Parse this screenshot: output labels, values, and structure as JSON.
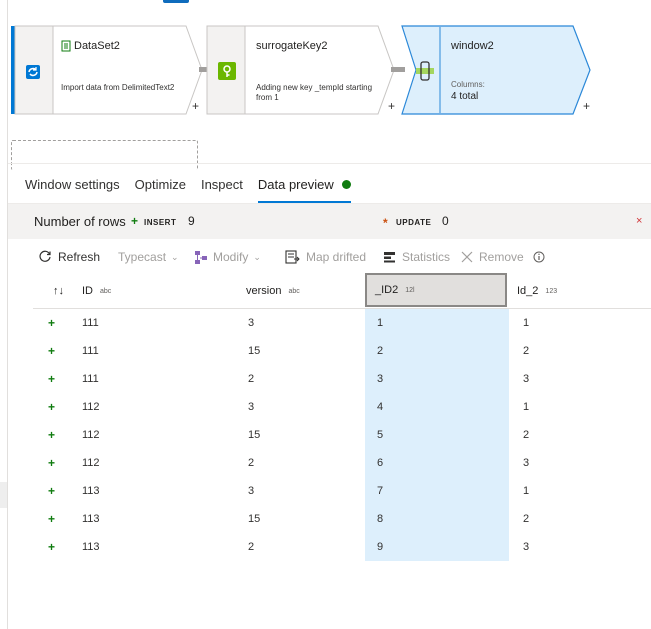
{
  "pipeline": {
    "nodes": [
      {
        "title": "DataSet2",
        "description": "Import data from DelimitedText2",
        "icon": "dataset-source-icon"
      },
      {
        "title": "surrogateKey2",
        "description": "Adding new key _tempId starting from 1",
        "icon": "surrogate-key-icon"
      },
      {
        "title": "window2",
        "label": "Columns:",
        "value": "4 total",
        "icon": "window-transform-icon"
      }
    ],
    "add_symbol": "+"
  },
  "tabs": [
    {
      "label": "Window settings"
    },
    {
      "label": "Optimize"
    },
    {
      "label": "Inspect"
    },
    {
      "label": "Data preview"
    }
  ],
  "active_tab": "Data preview",
  "summary": {
    "label": "Number of rows",
    "insert_label": "INSERT",
    "insert_mark": "+",
    "insert_count": "9",
    "update_label": "UPDATE",
    "update_mark": "*",
    "update_count": "0",
    "delete_mark": "×"
  },
  "toolbar": {
    "refresh": "Refresh",
    "typecast": "Typecast",
    "modify": "Modify",
    "map_drifted": "Map drifted",
    "statistics": "Statistics",
    "remove": "Remove",
    "sort_symbol": "↑↓"
  },
  "columns": [
    {
      "name": "ID",
      "type": "abc"
    },
    {
      "name": "version",
      "type": "abc"
    },
    {
      "name": "_ID2",
      "type": "12l"
    },
    {
      "name": "Id_2",
      "type": "123"
    }
  ],
  "rows": [
    {
      "mark": "+",
      "id": "111",
      "version": "3",
      "id2": "1",
      "id_2": "1"
    },
    {
      "mark": "+",
      "id": "111",
      "version": "15",
      "id2": "2",
      "id_2": "2"
    },
    {
      "mark": "+",
      "id": "111",
      "version": "2",
      "id2": "3",
      "id_2": "3"
    },
    {
      "mark": "+",
      "id": "112",
      "version": "3",
      "id2": "4",
      "id_2": "1"
    },
    {
      "mark": "+",
      "id": "112",
      "version": "15",
      "id2": "5",
      "id_2": "2"
    },
    {
      "mark": "+",
      "id": "112",
      "version": "2",
      "id2": "6",
      "id_2": "3"
    },
    {
      "mark": "+",
      "id": "113",
      "version": "3",
      "id2": "7",
      "id_2": "1"
    },
    {
      "mark": "+",
      "id": "113",
      "version": "15",
      "id2": "8",
      "id_2": "2"
    },
    {
      "mark": "+",
      "id": "113",
      "version": "2",
      "id2": "9",
      "id_2": "3"
    }
  ],
  "colors": {
    "accent": "#0078d4",
    "insert_green": "#107c10",
    "update_orange": "#ca5010",
    "delete_red": "#d13438",
    "selected_column_bg": "#ddeffc"
  }
}
